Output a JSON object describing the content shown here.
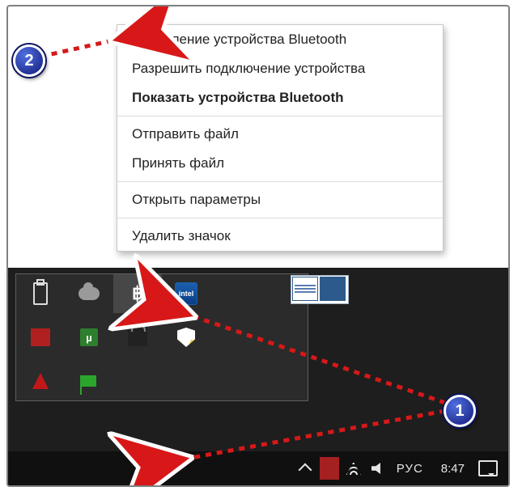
{
  "context_menu": {
    "items": [
      {
        "label": "Добавление устройства Bluetooth",
        "bold": false
      },
      {
        "label": "Разрешить подключение устройства",
        "bold": false
      },
      {
        "label": "Показать устройства Bluetooth",
        "bold": true
      }
    ],
    "items2": [
      {
        "label": "Отправить файл"
      },
      {
        "label": "Принять файл"
      }
    ],
    "items3": [
      {
        "label": "Открыть параметры"
      }
    ],
    "items4": [
      {
        "label": "Удалить значок"
      }
    ]
  },
  "tray_popup": {
    "row1": [
      "usb-device-icon",
      "onedrive-icon",
      "bluetooth-icon",
      "intel-graphics-icon"
    ],
    "row2_labels": {
      "utorrent": "µ"
    },
    "intel_text": "intel"
  },
  "taskbar": {
    "language": "РУС",
    "clock": "8:47"
  },
  "badges": {
    "one": "1",
    "two": "2"
  },
  "colors": {
    "accent": "#1a5fad",
    "arrow_red": "#d81818",
    "badge_fill": "#121a7a"
  }
}
